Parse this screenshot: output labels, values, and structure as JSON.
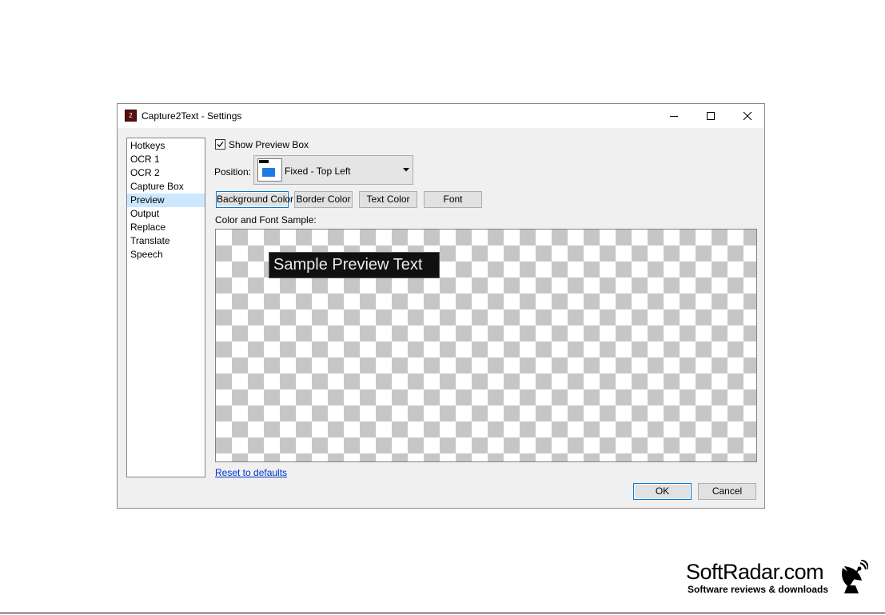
{
  "window": {
    "title": "Capture2Text - Settings",
    "app_icon_glyph": "2"
  },
  "sidebar": {
    "items": [
      {
        "label": "Hotkeys"
      },
      {
        "label": "OCR 1"
      },
      {
        "label": "OCR 2"
      },
      {
        "label": "Capture Box"
      },
      {
        "label": "Preview",
        "selected": true
      },
      {
        "label": "Output"
      },
      {
        "label": "Replace"
      },
      {
        "label": "Translate"
      },
      {
        "label": "Speech"
      }
    ]
  },
  "preview": {
    "show_preview_box_label": "Show Preview Box",
    "show_preview_box_checked": true,
    "position_label": "Position:",
    "position_value": "Fixed - Top Left",
    "buttons": {
      "background_color": "Background Color",
      "border_color": "Border Color",
      "text_color": "Text Color",
      "font": "Font"
    },
    "sample_label": "Color and Font Sample:",
    "sample_text": "Sample Preview Text",
    "reset_link": "Reset to defaults"
  },
  "dialog_buttons": {
    "ok": "OK",
    "cancel": "Cancel"
  },
  "watermark": {
    "title": "SoftRadar.com",
    "subtitle": "Software reviews & downloads"
  },
  "colors": {
    "selection": "#cce8ff",
    "focus_border": "#0078d7",
    "preview_bg": "#101010",
    "preview_text": "#e9e9e9",
    "link": "#0033cc",
    "position_icon_blue": "#1e7be6"
  }
}
